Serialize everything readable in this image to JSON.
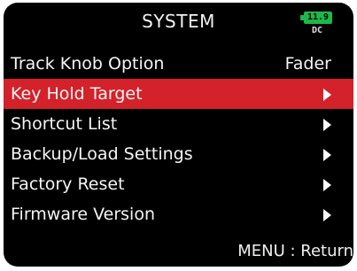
{
  "header": {
    "title": "SYSTEM",
    "battery_level": "11.9",
    "power_source": "DC",
    "battery_color": "#1db84a"
  },
  "menu": {
    "selected_color": "#d3222a",
    "items": [
      {
        "label": "Track Knob Option",
        "value": "Fader",
        "icon": "none",
        "selected": false
      },
      {
        "label": "Key Hold Target",
        "icon": "chevron-right-icon",
        "selected": true
      },
      {
        "label": "Shortcut List",
        "icon": "chevron-right-icon",
        "selected": false
      },
      {
        "label": "Backup/Load Settings",
        "icon": "chevron-right-icon",
        "selected": false
      },
      {
        "label": "Factory Reset",
        "icon": "chevron-right-icon",
        "selected": false
      },
      {
        "label": "Firmware Version",
        "icon": "chevron-right-icon",
        "selected": false
      }
    ]
  },
  "footer": {
    "hint": "MENU : Return"
  }
}
